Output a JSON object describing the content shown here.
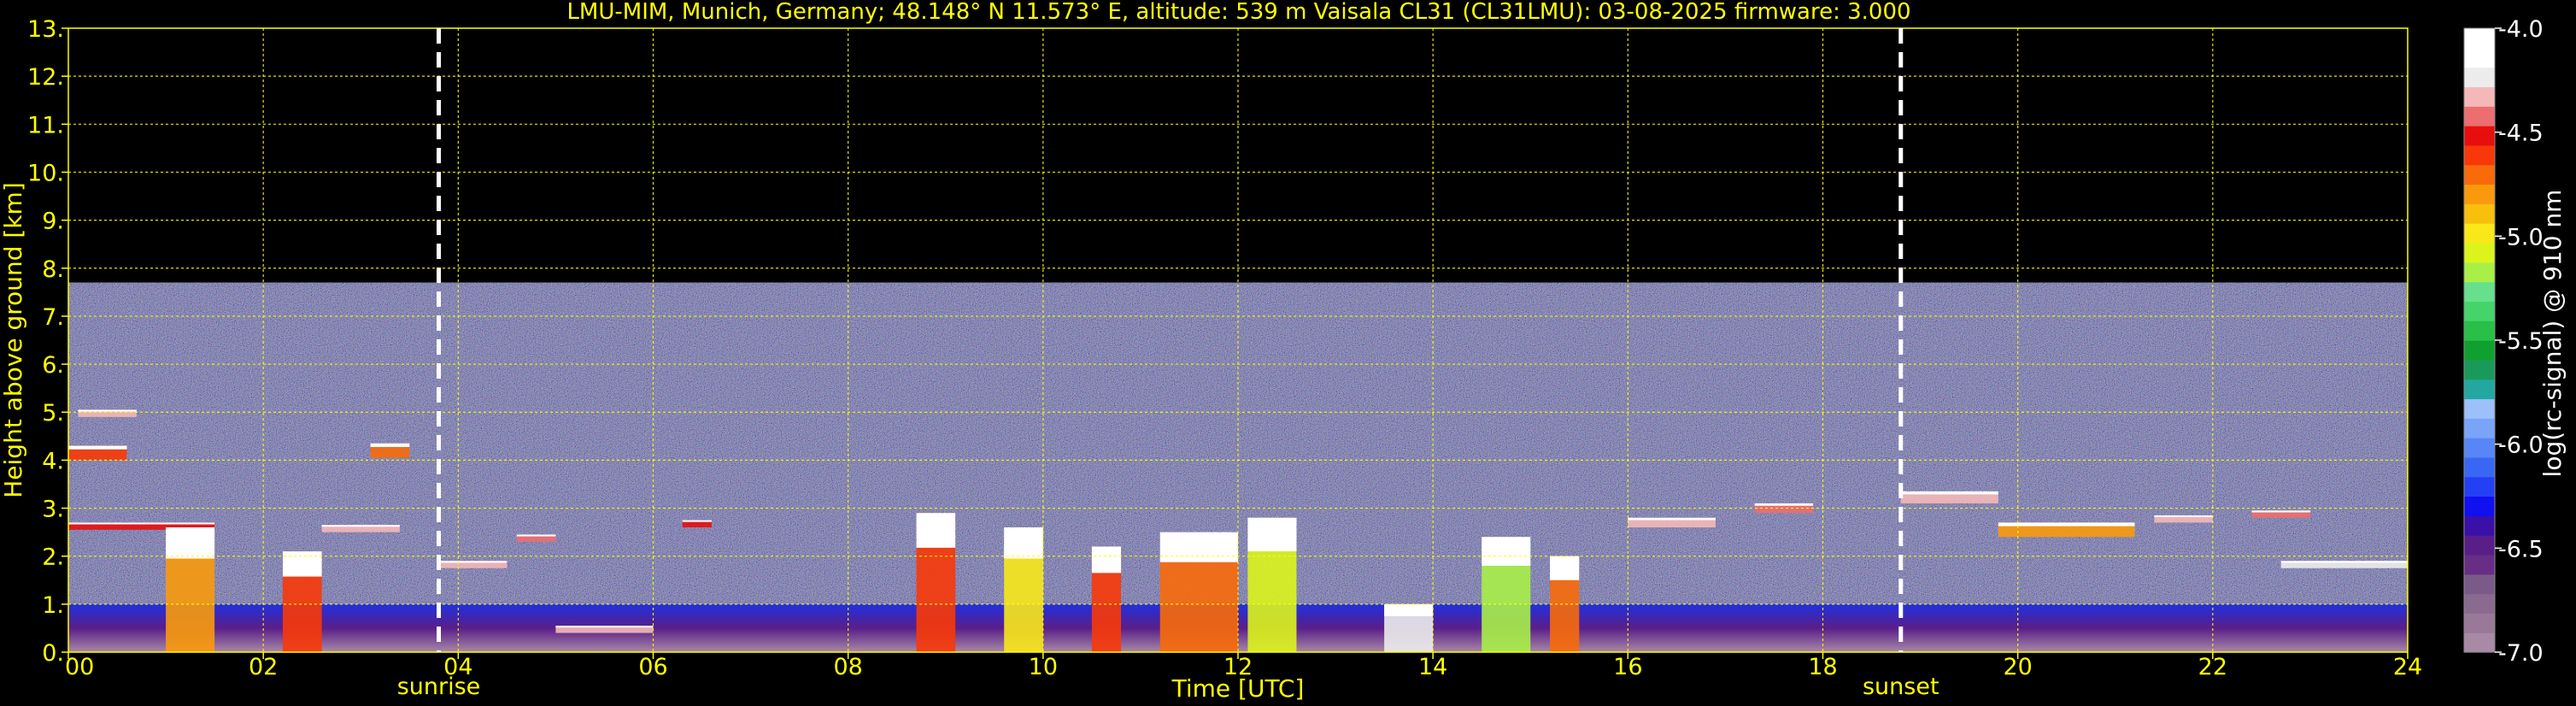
{
  "chart_data": {
    "type": "heatmap",
    "title": "LMU-MIM, Munich, Germany; 48.148° N 11.573° E, altitude: 539 m    Vaisala CL31 (CL31LMU): 03-08-2025    firmware: 3.000",
    "xlabel": "Time [UTC]",
    "ylabel": "Height above ground [km]",
    "xlim": [
      0,
      24
    ],
    "ylim": [
      0,
      13
    ],
    "x_ticks": [
      0,
      2,
      4,
      6,
      8,
      10,
      12,
      14,
      16,
      18,
      20,
      22,
      24
    ],
    "x_tick_labels": [
      "00",
      "02",
      "04",
      "06",
      "08",
      "10",
      "12",
      "14",
      "16",
      "18",
      "20",
      "22",
      "24"
    ],
    "y_ticks": [
      0,
      1,
      2,
      3,
      4,
      5,
      6,
      7,
      8,
      9,
      10,
      11,
      12,
      13
    ],
    "y_tick_labels": [
      "0.",
      "1.",
      "2.",
      "3.",
      "4.",
      "5.",
      "6.",
      "7.",
      "8.",
      "9.",
      "10.",
      "11.",
      "12.",
      "13."
    ],
    "grid": true,
    "grid_color": "#ffff00",
    "signal_top_km": 7.7,
    "markers": [
      {
        "label": "sunrise",
        "time_utc": 3.8
      },
      {
        "label": "sunset",
        "time_utc": 18.8
      }
    ],
    "colorbar": {
      "label": "log(rc-signal) @ 910 nm",
      "range": [
        -7.0,
        -4.0
      ],
      "ticks": [
        -4.0,
        -4.5,
        -5.0,
        -5.5,
        -6.0,
        -6.5,
        -7.0
      ],
      "tick_labels": [
        "-4.0",
        "-4.5",
        "-5.0",
        "-5.5",
        "-6.0",
        "-6.5",
        "-7.0"
      ],
      "colors": [
        "#a88aa6",
        "#9a7898",
        "#8a6a8e",
        "#7a5a86",
        "#682e86",
        "#5a1e88",
        "#3a10a8",
        "#1010f0",
        "#2440f4",
        "#3a66f4",
        "#5886f6",
        "#7aa4f8",
        "#9cc0fa",
        "#22a8a0",
        "#1a9a5a",
        "#10a030",
        "#28c048",
        "#44d46a",
        "#66e08c",
        "#a8f048",
        "#dcf41c",
        "#f8e81a",
        "#f8c00c",
        "#f89a0c",
        "#f86a0a",
        "#f83808",
        "#e80e0e",
        "#ec6e6e",
        "#f4b8b8",
        "#ececec",
        "#ffffff",
        "#ffffff"
      ]
    },
    "cloud_layers": [
      {
        "t_start": 0.0,
        "t_end": 0.6,
        "h_bottom": 4.0,
        "h_top": 4.3,
        "signal": -4.6
      },
      {
        "t_start": 0.1,
        "t_end": 0.7,
        "h_bottom": 4.9,
        "h_top": 5.05,
        "signal": -4.3
      },
      {
        "t_start": 0.0,
        "t_end": 1.5,
        "h_bottom": 2.55,
        "h_top": 2.7,
        "signal": -4.5
      },
      {
        "t_start": 1.0,
        "t_end": 1.5,
        "h_bottom": 0.0,
        "h_top": 2.6,
        "signal": -4.8
      },
      {
        "t_start": 2.2,
        "t_end": 2.6,
        "h_bottom": 0.0,
        "h_top": 2.1,
        "signal": -4.6
      },
      {
        "t_start": 2.6,
        "t_end": 3.4,
        "h_bottom": 2.5,
        "h_top": 2.65,
        "signal": -4.3
      },
      {
        "t_start": 3.1,
        "t_end": 3.5,
        "h_bottom": 4.05,
        "h_top": 4.35,
        "signal": -4.7
      },
      {
        "t_start": 3.8,
        "t_end": 4.5,
        "h_bottom": 1.75,
        "h_top": 1.9,
        "signal": -4.3
      },
      {
        "t_start": 4.6,
        "t_end": 5.0,
        "h_bottom": 2.3,
        "h_top": 2.45,
        "signal": -4.4
      },
      {
        "t_start": 5.0,
        "t_end": 6.0,
        "h_bottom": 0.4,
        "h_top": 0.55,
        "signal": -4.3
      },
      {
        "t_start": 6.3,
        "t_end": 6.6,
        "h_bottom": 2.6,
        "h_top": 2.75,
        "signal": -4.5
      },
      {
        "t_start": 8.7,
        "t_end": 9.1,
        "h_bottom": 0.0,
        "h_top": 2.9,
        "signal": -4.6
      },
      {
        "t_start": 9.6,
        "t_end": 10.0,
        "h_bottom": 0.0,
        "h_top": 2.6,
        "signal": -5.0
      },
      {
        "t_start": 10.5,
        "t_end": 10.8,
        "h_bottom": 0.0,
        "h_top": 2.2,
        "signal": -4.6
      },
      {
        "t_start": 11.2,
        "t_end": 12.0,
        "h_bottom": 0.0,
        "h_top": 2.5,
        "signal": -4.7
      },
      {
        "t_start": 12.1,
        "t_end": 12.6,
        "h_bottom": 0.0,
        "h_top": 2.8,
        "signal": -5.1
      },
      {
        "t_start": 13.5,
        "t_end": 14.0,
        "h_bottom": 0.0,
        "h_top": 1.0,
        "signal": -4.2
      },
      {
        "t_start": 14.5,
        "t_end": 15.0,
        "h_bottom": 0.0,
        "h_top": 2.4,
        "signal": -5.2
      },
      {
        "t_start": 15.2,
        "t_end": 15.5,
        "h_bottom": 0.0,
        "h_top": 2.0,
        "signal": -4.7
      },
      {
        "t_start": 16.0,
        "t_end": 16.9,
        "h_bottom": 2.6,
        "h_top": 2.8,
        "signal": -4.3
      },
      {
        "t_start": 17.3,
        "t_end": 17.9,
        "h_bottom": 2.9,
        "h_top": 3.1,
        "signal": -4.4
      },
      {
        "t_start": 18.8,
        "t_end": 19.8,
        "h_bottom": 3.1,
        "h_top": 3.35,
        "signal": -4.3
      },
      {
        "t_start": 19.8,
        "t_end": 21.2,
        "h_bottom": 2.4,
        "h_top": 2.7,
        "signal": -4.8
      },
      {
        "t_start": 21.4,
        "t_end": 22.0,
        "h_bottom": 2.7,
        "h_top": 2.85,
        "signal": -4.3
      },
      {
        "t_start": 22.4,
        "t_end": 23.0,
        "h_bottom": 2.8,
        "h_top": 2.95,
        "signal": -4.4
      },
      {
        "t_start": 22.7,
        "t_end": 24.0,
        "h_bottom": 1.75,
        "h_top": 1.9,
        "signal": -4.2
      }
    ]
  }
}
